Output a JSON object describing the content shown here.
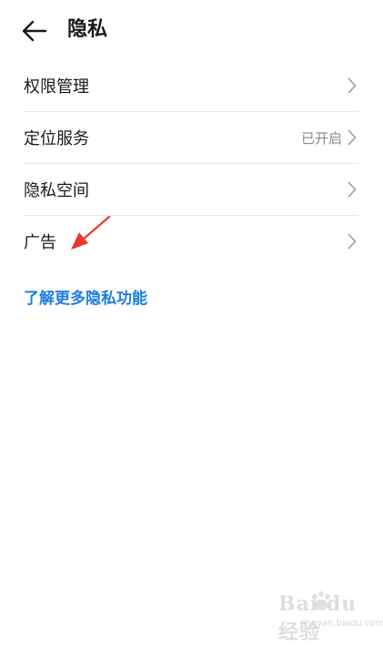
{
  "header": {
    "back_icon": "arrow-left-icon",
    "title": "隐私"
  },
  "settings": {
    "items": [
      {
        "label": "权限管理",
        "status": "",
        "chevron_icon": "chevron-right-icon"
      },
      {
        "label": "定位服务",
        "status": "已开启",
        "chevron_icon": "chevron-right-icon"
      },
      {
        "label": "隐私空间",
        "status": "",
        "chevron_icon": "chevron-right-icon"
      },
      {
        "label": "广告",
        "status": "",
        "chevron_icon": "chevron-right-icon"
      }
    ]
  },
  "learn_more": {
    "label": "了解更多隐私功能"
  },
  "annotation": {
    "arrow_color": "#e8382f"
  },
  "watermark": {
    "logo_text": "Bai du 经验",
    "url": "jingyan.baidu.com"
  },
  "colors": {
    "link": "#1d7ee0",
    "divider": "#e8e8e8",
    "status_text": "#8a8a8a",
    "chevron": "#9b9b9b"
  }
}
